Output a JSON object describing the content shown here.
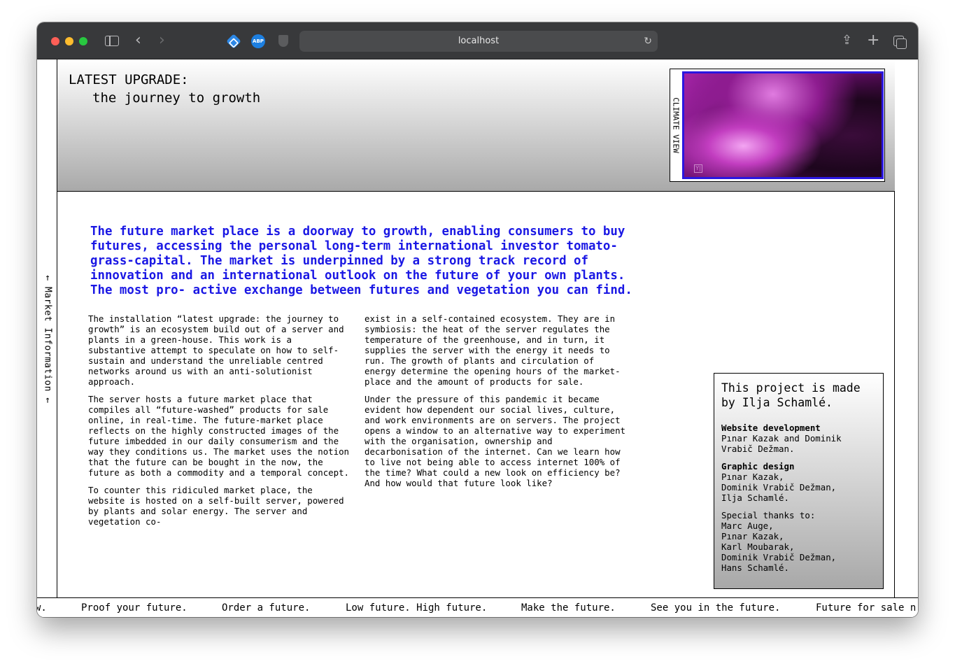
{
  "browser": {
    "url": "localhost",
    "extensions": [
      "puzzle-extension-icon",
      "ABP",
      "shield-icon"
    ]
  },
  "side_rail": {
    "label": "← Market Information ←"
  },
  "header": {
    "title": "LATEST UPGRADE:",
    "subtitle": "the journey to growth",
    "climate_label": "CLIMATE VIEW",
    "climate_logo": "Y|"
  },
  "lead_text": "The future market place is a doorway to growth, enabling consumers to buy futures, accessing the personal long-term international investor tomato-grass-capital. The market is underpinned by a strong track record of innovation and an international outlook on the future of your own plants. The most pro- active exchange between futures and vegetation you can find.",
  "columns": {
    "left": [
      "The installation “latest upgrade: the journey to growth” is an ecosystem build out of a server and plants in a green-house. This work is a substantive attempt to speculate on how to self-sustain and understand the unreliable centred networks around us with an anti-solutionist approach.",
      "The server hosts a future market place that compiles all “future-washed” products for sale online, in real-time. The future-market place reflects on the highly constructed images of the future imbedded in our daily consumerism and the way they conditions us. The market uses the notion that the future can be bought in the now, the future as both a commodity and a temporal concept.",
      "To counter this ridiculed market place, the website is hosted on a self-built server, powered by plants and solar energy. The server and vegetation co-"
    ],
    "right": [
      "exist in a self-contained ecosystem. They are in symbiosis: the heat of the server regulates the temperature of the greenhouse, and in turn, it supplies the server with the energy it needs to run. The growth of plants and circulation of energy determine the opening hours of the market-place and the amount of products for sale.",
      "Under the pressure of this pandemic it became evident how dependent our social lives, culture, and work environments are on servers. The project opens a window to an alternative way to experiment with the organisation, ownership and decarbonisation of the internet. Can we learn how to live not being able to access internet 100% of the time? What could a new look on efficiency be? And how would that future look like?"
    ]
  },
  "credits": {
    "title": "This project is made by Ilja Schamlé.",
    "website_heading": "Website development",
    "website_names": "Pınar Kazak and Dominik Vrabič Dežman.",
    "design_heading": "Graphic design",
    "design_names": [
      "Pınar Kazak,",
      "Dominik Vrabič Dežman,",
      "Ilja Schamlé."
    ],
    "thanks_heading": "Special thanks to:",
    "thanks_names": [
      "Marc Auge,",
      "Pınar Kazak,",
      "Karl Moubarak,",
      "Dominik Vrabič Dežman,",
      "Hans Schamlé."
    ]
  },
  "ticker": [
    "w.",
    "Proof your future.",
    "Order a future.",
    "Low future. High future.",
    "Make the future.",
    "See you in the future.",
    "Future for sale n"
  ]
}
